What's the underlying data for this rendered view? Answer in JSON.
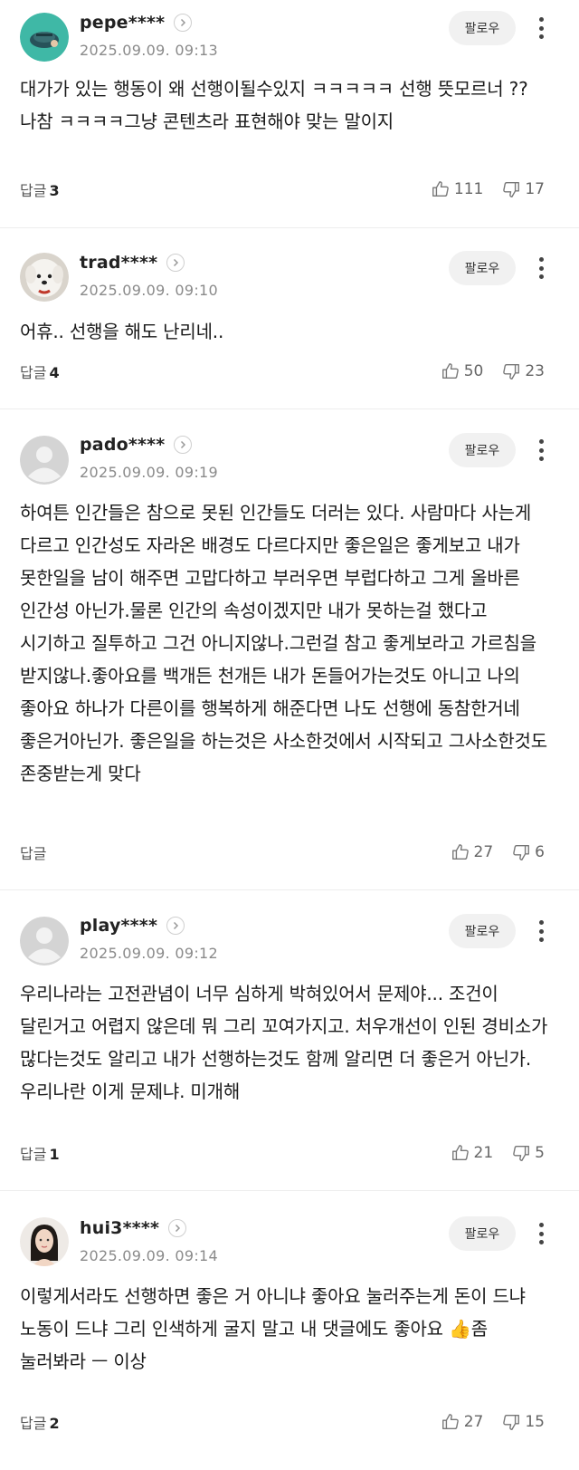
{
  "comments": [
    {
      "nickname": "pepe****",
      "date": "2025.09.09.  09:13",
      "follow_label": "팔로우",
      "text": "대가가 있는 행동이 왜 선행이될수있지 ㅋㅋㅋㅋㅋ 선행 뜻모르너 ?? 나참 ㅋㅋㅋㅋ그냥 콘텐츠라 표현해야 맞는 말이지",
      "reply_label": "답글",
      "reply_count": "3",
      "likes": "111",
      "dislikes": "17",
      "avatar": "teal-cartoon-avatar"
    },
    {
      "nickname": "trad****",
      "date": "2025.09.09.  09:10",
      "follow_label": "팔로우",
      "text": "어휴.. 선행을 해도 난리네..",
      "reply_label": "답글",
      "reply_count": "4",
      "likes": "50",
      "dislikes": "23",
      "avatar": "white-dog-photo"
    },
    {
      "nickname": "pado****",
      "date": "2025.09.09.  09:19",
      "follow_label": "팔로우",
      "text": "하여튼 인간들은 참으로 못된 인간들도 더러는 있다. 사람마다 사는게 다르고 인간성도 자라온 배경도 다르다지만 좋은일은 좋게보고 내가 못한일을 남이 해주면 고맙다하고 부러우면 부럽다하고 그게 올바른 인간성 아닌가.물론 인간의 속성이겠지만 내가 못하는걸 했다고 시기하고 질투하고 그건 아니지않나.그런걸 참고 좋게보라고 가르침을 받지않나.좋아요를 백개든 천개든 내가 돈들어가는것도 아니고 나의 좋아요 하나가 다른이를 행복하게 해준다면 나도 선행에 동참한거네 좋은거아닌가. 좋은일을 하는것은 사소한것에서 시작되고 그사소한것도 존중받는게 맞다",
      "reply_label": "답글",
      "reply_count": "",
      "likes": "27",
      "dislikes": "6",
      "avatar": "default-avatar"
    },
    {
      "nickname": "play****",
      "date": "2025.09.09.  09:12",
      "follow_label": "팔로우",
      "text": "우리나라는 고전관념이 너무 심하게 박혀있어서 문제야... 조건이 달린거고 어렵지 않은데 뭐 그리 꼬여가지고. 처우개선이 인된 경비소가 많다는것도 알리고 내가 선행하는것도 함께 알리면 더 좋은거 아닌가. 우리나란 이게 문제냐. 미개해",
      "reply_label": "답글",
      "reply_count": "1",
      "likes": "21",
      "dislikes": "5",
      "avatar": "default-avatar"
    },
    {
      "nickname": "hui3****",
      "date": "2025.09.09.  09:14",
      "follow_label": "팔로우",
      "text": "이렇게서라도 선행하면 좋은 거 아니냐 좋아요 눌러주는게 돈이 드냐 노동이 드냐 그리 인색하게 굴지 말고 내 댓글에도 좋아요 👍좀 눌러봐라 ㅡ 이상",
      "reply_label": "답글",
      "reply_count": "2",
      "likes": "27",
      "dislikes": "15",
      "avatar": "woman-photo"
    }
  ]
}
